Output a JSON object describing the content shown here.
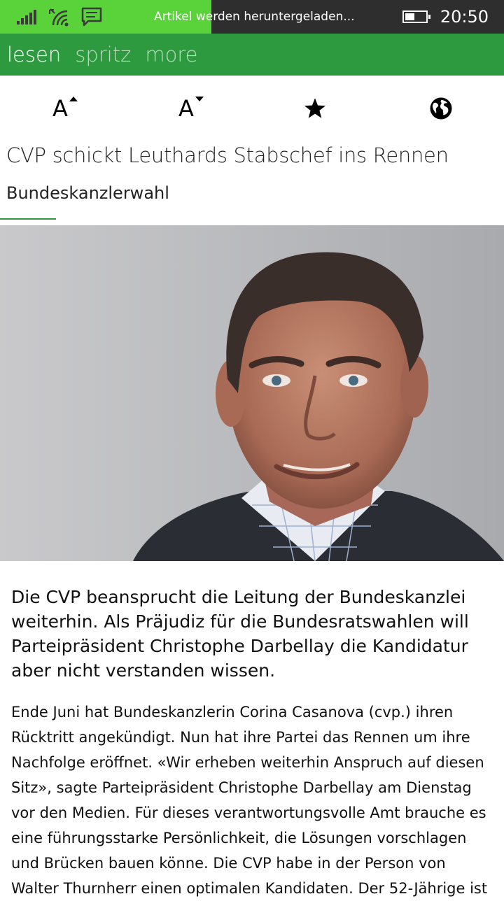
{
  "status_bar": {
    "message": "Artikel werden heruntergeladen...",
    "time": "20:50",
    "download_progress": 0.42,
    "battery_level": 0.55,
    "progress_color": "#5ad33a"
  },
  "app_bar": {
    "tabs": [
      {
        "label": "lesen",
        "active": true
      },
      {
        "label": "spritz",
        "active": false
      },
      {
        "label": "more",
        "active": false
      }
    ],
    "accent_color": "#2e9a3f"
  },
  "toolbar": {
    "increase_font_letter": "A",
    "decrease_font_letter": "A",
    "icons": [
      "font-increase-icon",
      "font-decrease-icon",
      "star-icon",
      "globe-icon"
    ]
  },
  "article": {
    "title": "CVP schickt Leuthards Stabschef ins Rennen",
    "category": "Bundeskanzlerwahl",
    "lead": "Die CVP beansprucht die Leitung der Bundeskanzlei weiterhin. Als Präjudiz für die Bundesratswahlen will Parteipräsident Christophe Darbellay die Kandidatur aber nicht verstanden wissen.",
    "body": "Ende Juni hat Bundeskanzlerin Corina Casanova (cvp.) ihren Rücktritt angekündigt. Nun hat ihre Partei das Rennen um ihre Nachfolge eröffnet. «Wir erheben weiterhin Anspruch auf diesen Sitz», sagte Parteipräsident Christophe Darbellay am Dienstag vor den Medien. Für dieses verantwortungsvolle Amt brauche es eine führungsstarke Persönlichkeit, die Lösungen vorschlagen und Brücken bauen könne. Die CVP habe in der Person von Walter Thurnherr einen optimalen Kandidaten. Der 52-Jährige ist"
  }
}
